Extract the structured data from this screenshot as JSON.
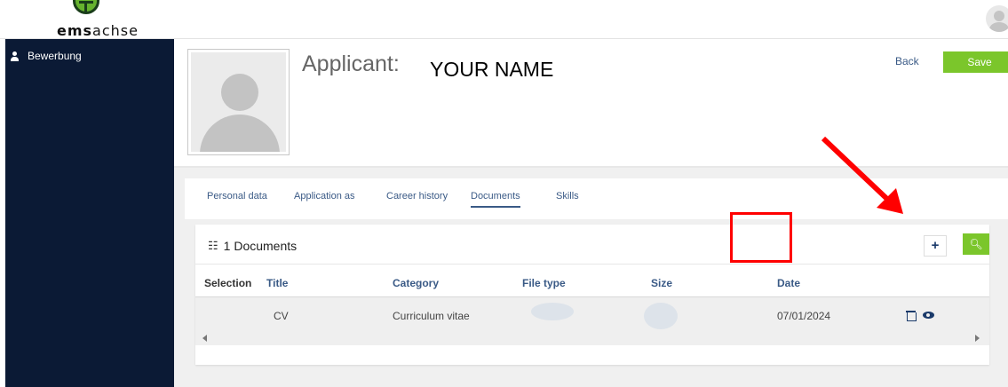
{
  "app": {
    "logo_bold": "ems",
    "logo_rest": "achse"
  },
  "sidebar": {
    "items": [
      {
        "label": "Bewerbung",
        "icon": "person-icon"
      }
    ]
  },
  "header": {
    "applicant_label": "Applicant:",
    "applicant_name": "YOUR NAME",
    "back_label": "Back",
    "save_label": "Save"
  },
  "tabs": [
    {
      "label": "Personal data"
    },
    {
      "label": "Application as"
    },
    {
      "label": "Career history"
    },
    {
      "label": "Documents",
      "active": true
    },
    {
      "label": "Skills"
    }
  ],
  "documents": {
    "title": "1 Documents",
    "add_label": "+",
    "columns": [
      "Selection",
      "Title",
      "Category",
      "File type",
      "Size",
      "Date"
    ],
    "rows": [
      {
        "title": "CV",
        "category": "Curriculum vitae",
        "date": "07/01/2024"
      }
    ]
  },
  "colors": {
    "accent_green": "#7bc62b",
    "sidebar_navy": "#0b1a35",
    "link_blue": "#3a5a86",
    "annotation_red": "#ff0000"
  }
}
